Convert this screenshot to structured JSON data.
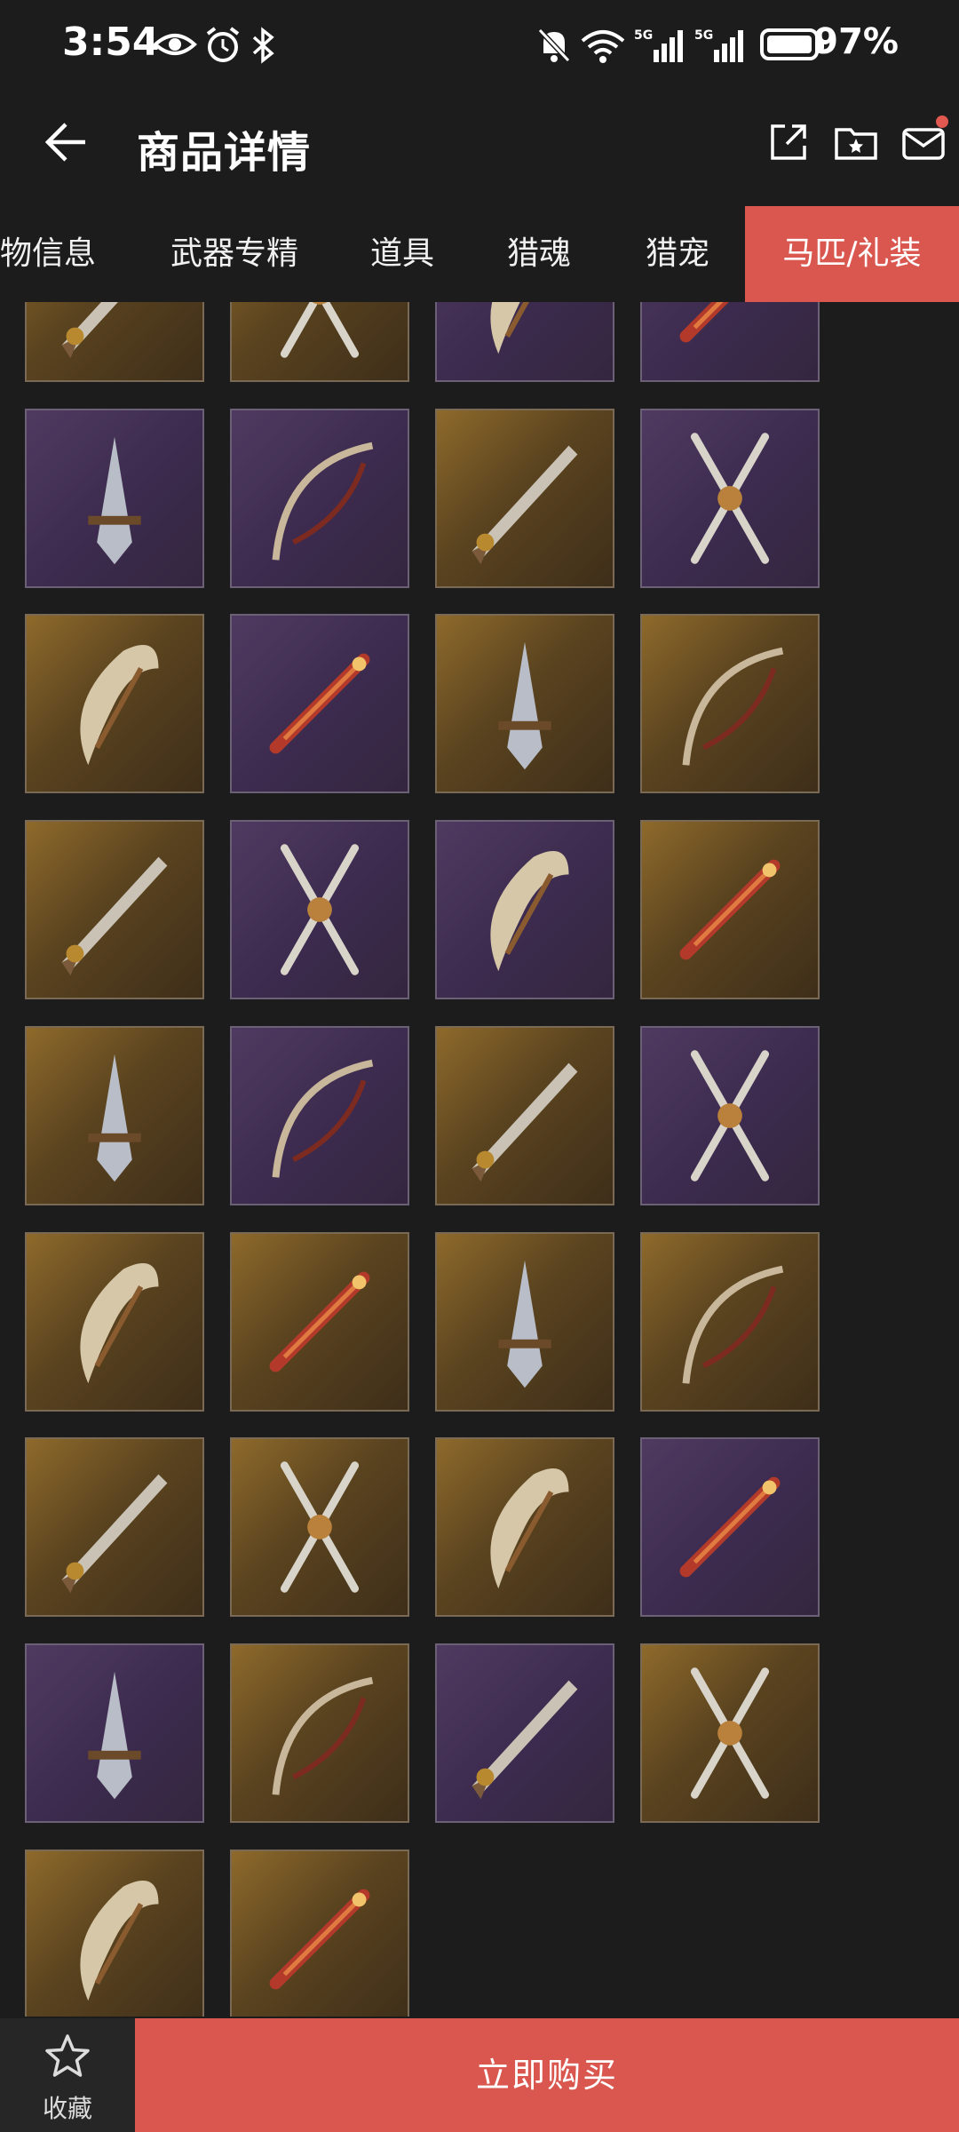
{
  "status_bar": {
    "time": "3:54",
    "battery": "97%",
    "icons": [
      "eye-icon",
      "alarm-icon",
      "bluetooth-icon",
      "mute-icon",
      "wifi-icon",
      "signal-5g-icon",
      "signal-5g-icon",
      "battery-icon"
    ]
  },
  "header": {
    "title": "商品详情",
    "icons": [
      "back-arrow-icon",
      "share-icon",
      "folder-star-icon",
      "mail-icon"
    ]
  },
  "tabs": [
    {
      "label": "物信息"
    },
    {
      "label": "武器专精"
    },
    {
      "label": "道具"
    },
    {
      "label": "猎魂"
    },
    {
      "label": "猎宠"
    },
    {
      "label": "马匹/礼装",
      "active": true
    }
  ],
  "grid": {
    "rows": [
      [
        "gold",
        "gold",
        "purple",
        "purple"
      ],
      [
        "purple",
        "purple",
        "gold",
        "purple"
      ],
      [
        "gold",
        "purple",
        "gold",
        "gold"
      ],
      [
        "gold",
        "purple",
        "purple",
        "gold"
      ],
      [
        "gold",
        "purple",
        "gold",
        "purple"
      ],
      [
        "gold",
        "gold",
        "gold",
        "gold"
      ],
      [
        "gold",
        "gold",
        "gold",
        "purple"
      ],
      [
        "purple",
        "gold",
        "purple",
        "gold"
      ],
      [
        "gold",
        "gold"
      ]
    ]
  },
  "bottom_bar": {
    "favorite_label": "收藏",
    "buy_label": "立即购买"
  },
  "colors": {
    "accent": "#d9574f",
    "background": "#1c1c1d",
    "tile_purple": "#3c2b4e",
    "tile_gold": "#5a431f"
  }
}
